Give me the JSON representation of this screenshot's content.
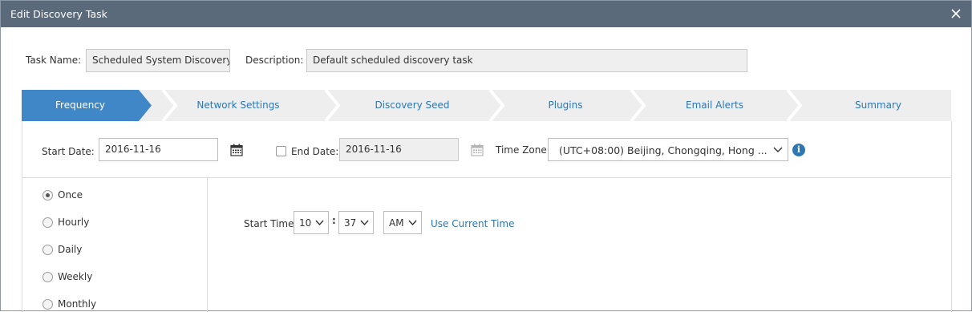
{
  "dialog": {
    "title": "Edit Discovery Task"
  },
  "task": {
    "name_label": "Task Name:",
    "name_value": "Scheduled System Discovery",
    "description_label": "Description:",
    "description_value": "Default scheduled discovery task"
  },
  "steps": [
    {
      "label": "Frequency",
      "active": true
    },
    {
      "label": "Network Settings",
      "active": false
    },
    {
      "label": "Discovery Seed",
      "active": false
    },
    {
      "label": "Plugins",
      "active": false
    },
    {
      "label": "Email Alerts",
      "active": false
    },
    {
      "label": "Summary",
      "active": false
    }
  ],
  "schedule": {
    "start_date_label": "Start Date:",
    "start_date_value": "2016-11-16",
    "end_date_label": "End Date:",
    "end_date_value": "2016-11-16",
    "end_date_enabled": false,
    "timezone_label": "Time Zone:",
    "timezone_value": "(UTC+08:00) Beijing, Chongqing, Hong ..."
  },
  "frequency_options": [
    {
      "label": "Once",
      "checked": true
    },
    {
      "label": "Hourly",
      "checked": false
    },
    {
      "label": "Daily",
      "checked": false
    },
    {
      "label": "Weekly",
      "checked": false
    },
    {
      "label": "Monthly",
      "checked": false
    }
  ],
  "start_time": {
    "label": "Start Time",
    "hour": "10",
    "separator": ":",
    "minute": "37",
    "ampm": "AM",
    "use_current_label": "Use Current Time"
  },
  "icons": {
    "close": "close-icon",
    "calendar": "calendar-icon",
    "info": "info-icon",
    "dropdown": "chevron-down-icon"
  },
  "colors": {
    "titlebar": "#5a6a7b",
    "active_step": "#3f87c7",
    "link": "#2c77b4"
  }
}
